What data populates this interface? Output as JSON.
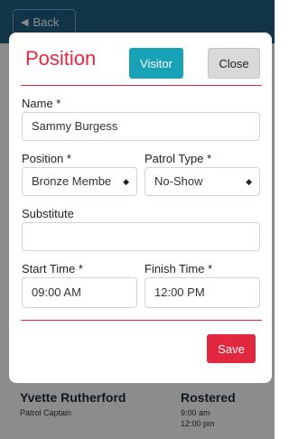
{
  "background": {
    "back_label": "Back",
    "member_name": "Yvette Rutherford",
    "member_role": "Patrol Captain",
    "status": "Rostered",
    "start": "9:00 am",
    "finish": "12:00 pm"
  },
  "modal": {
    "title": "Position",
    "visitor_label": "Visitor",
    "close_label": "Close",
    "name_label": "Name *",
    "name_value": "Sammy Burgess",
    "position_label": "Position *",
    "position_value": "Bronze Membe",
    "patrol_type_label": "Patrol Type *",
    "patrol_type_value": "No-Show",
    "substitute_label": "Substitute",
    "substitute_value": "",
    "start_time_label": "Start Time *",
    "start_time_value": "09:00 AM",
    "finish_time_label": "Finish Time *",
    "finish_time_value": "12:00 PM",
    "save_label": "Save"
  },
  "colors": {
    "accent": "#e2283f",
    "visitor": "#17a2b8",
    "header_bg": "#1f5f86"
  },
  "icons": {
    "back": "arrow-left-icon",
    "select_caret": "sort-caret-icon"
  }
}
